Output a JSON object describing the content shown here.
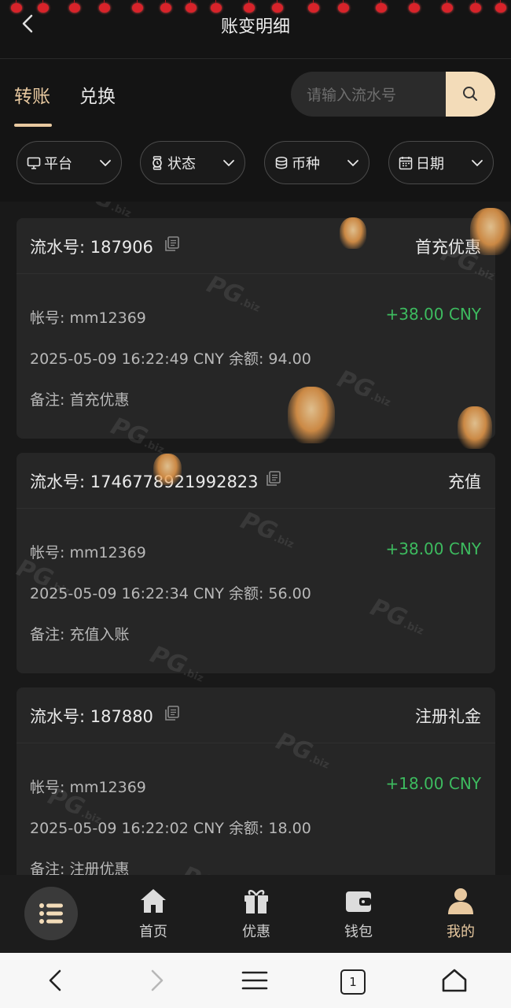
{
  "header": {
    "title": "账变明细"
  },
  "tabs": [
    {
      "label": "转账",
      "active": true
    },
    {
      "label": "兑换",
      "active": false
    }
  ],
  "search": {
    "placeholder": "请输入流水号"
  },
  "filters": [
    {
      "label": "平台",
      "icon": "monitor-icon"
    },
    {
      "label": "状态",
      "icon": "watch-icon"
    },
    {
      "label": "币种",
      "icon": "coins-icon"
    },
    {
      "label": "日期",
      "icon": "calendar-icon"
    }
  ],
  "records": [
    {
      "serial": "流水号: 187906",
      "type": "首充优惠",
      "account": "帐号: mm12369",
      "amount": "+38.00 CNY",
      "time_balance": "2025-05-09 16:22:49 CNY 余额: 94.00",
      "note": "备注: 首充优惠"
    },
    {
      "serial": "流水号: 1746778921992823",
      "type": "充值",
      "account": "帐号: mm12369",
      "amount": "+38.00 CNY",
      "time_balance": "2025-05-09 16:22:34 CNY 余额: 56.00",
      "note": "备注: 充值入账"
    },
    {
      "serial": "流水号: 187880",
      "type": "注册礼金",
      "account": "帐号: mm12369",
      "amount": "+18.00 CNY",
      "time_balance": "2025-05-09 16:22:02 CNY 余额: 18.00",
      "note": "备注: 注册优惠"
    }
  ],
  "bottom_nav": [
    {
      "label": "首页",
      "icon": "home-icon"
    },
    {
      "label": "优惠",
      "icon": "gift-icon"
    },
    {
      "label": "钱包",
      "icon": "wallet-icon"
    },
    {
      "label": "我的",
      "icon": "user-icon",
      "active": true
    }
  ],
  "watermark": "PG",
  "watermark_suffix": ".biz",
  "browser": {
    "tab_count": "1"
  },
  "colors": {
    "accent": "#e8c9a0",
    "positive": "#3dbb5f",
    "background": "#141414",
    "card": "#262626"
  }
}
